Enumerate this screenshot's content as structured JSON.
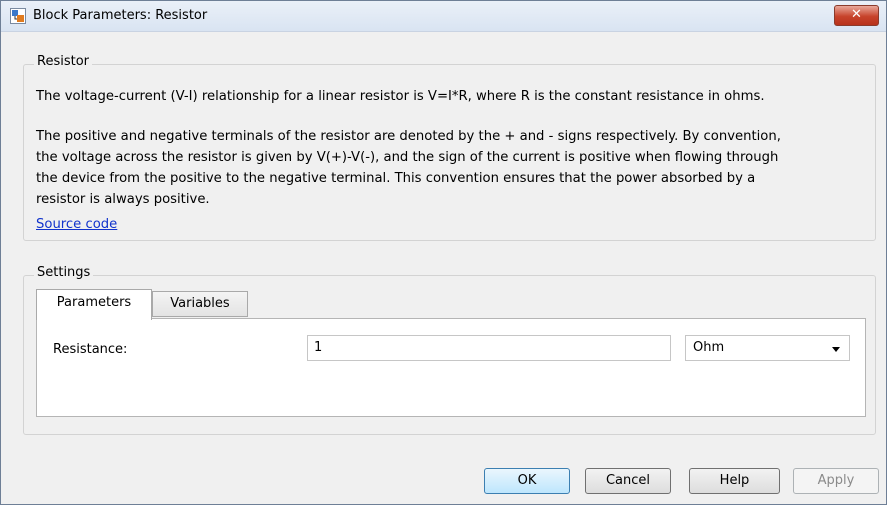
{
  "window": {
    "title": "Block Parameters: Resistor",
    "close_label": "✕"
  },
  "block": {
    "name": "Resistor",
    "description_lines": [
      "The voltage-current (V-I) relationship for a linear resistor is V=I*R, where R is the constant resistance in ohms.",
      "The positive and negative terminals of the resistor are denoted by the + and - signs respectively. By convention,",
      "the voltage across the resistor is given by V(+)-V(-), and the sign of the current is positive when flowing through",
      "the device from the positive to the negative terminal. This convention ensures that the power absorbed by a",
      "resistor is always positive."
    ],
    "source_link": "Source code"
  },
  "settings": {
    "legend": "Settings",
    "tabs": [
      {
        "label": "Parameters",
        "active": true
      },
      {
        "label": "Variables",
        "active": false
      }
    ],
    "params": [
      {
        "label": "Resistance:",
        "value": "1",
        "unit": "Ohm"
      }
    ]
  },
  "buttons": {
    "ok": "OK",
    "cancel": "Cancel",
    "help": "Help",
    "apply": "Apply"
  },
  "colors": {
    "link": "#1133cc",
    "close_button": "#c7432b",
    "default_button": "#bee6fd"
  }
}
